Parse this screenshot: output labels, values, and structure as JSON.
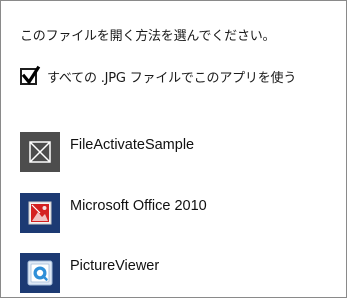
{
  "dialog": {
    "prompt": "このファイルを開く方法を選んでください。",
    "always_use": {
      "label": "すべての .JPG ファイルでこのアプリを使う",
      "checked": true
    },
    "apps": [
      {
        "name": "FileActivateSample",
        "icon": "placeholder-x-icon",
        "tile_color": "#4d4d4d"
      },
      {
        "name": "Microsoft Office 2010",
        "icon": "office-picture-manager-icon",
        "tile_color": "#1c3a73"
      },
      {
        "name": "PictureViewer",
        "icon": "picture-viewer-icon",
        "tile_color": "#1c3a73"
      }
    ]
  }
}
